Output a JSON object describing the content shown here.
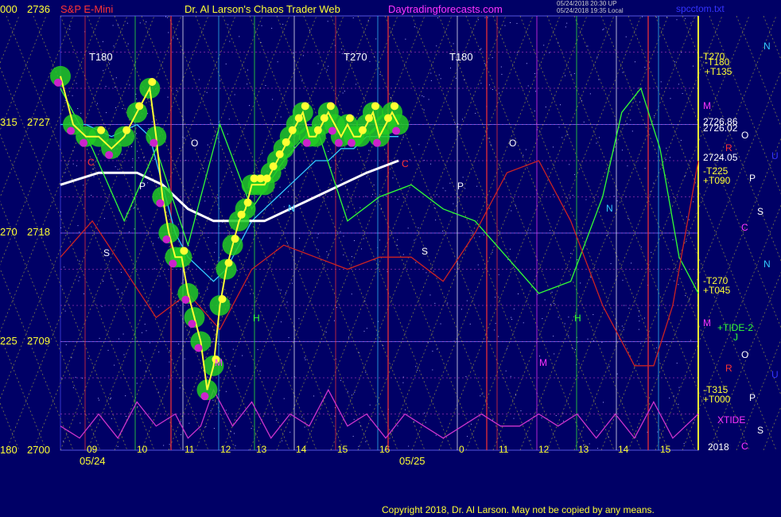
{
  "header": {
    "price_scale": "000",
    "price_top": "2736",
    "symbol": "S&P E-Mini",
    "title": "Dr. Al Larson's Chaos Trader Web",
    "site": "Daytradingforecasts.com",
    "stamp_line1": "05/24/2018 20:30 UP",
    "stamp_line2": "05/24/2018 19:35 Local",
    "filename": "spcctom.txt"
  },
  "axis_left": [
    {
      "scale": "315",
      "price": "2727"
    },
    {
      "scale": "270",
      "price": "2718"
    },
    {
      "scale": "225",
      "price": "2709"
    },
    {
      "scale": "180",
      "price": "2700"
    }
  ],
  "dates": [
    "05/24",
    "05/25"
  ],
  "hours": [
    "09",
    "10",
    "11",
    "12",
    "13",
    "14",
    "15",
    "16",
    "0",
    "11",
    "12",
    "13",
    "14",
    "15"
  ],
  "time_markers": [
    "T180",
    "T270",
    "T180"
  ],
  "right_labels": [
    {
      "text": "-T270",
      "color": "#ffff33"
    },
    {
      "text": "-T180",
      "color": "#ffff33"
    },
    {
      "text": "+T135",
      "color": "#ffff33"
    },
    {
      "text": "M",
      "color": "#ff33ff"
    },
    {
      "text": "2726.86",
      "color": "#ffffff"
    },
    {
      "text": "2726.02",
      "color": "#ffffff"
    },
    {
      "text": "R",
      "color": "#ff3333"
    },
    {
      "text": "2724.05",
      "color": "#ffffff"
    },
    {
      "text": "-T225",
      "color": "#ffff33"
    },
    {
      "text": "+T090",
      "color": "#ffff33"
    },
    {
      "text": "-T270",
      "color": "#ffff33"
    },
    {
      "text": "+T045",
      "color": "#ffff33"
    },
    {
      "text": "M",
      "color": "#ff33ff"
    },
    {
      "text": "+TIDE-2",
      "color": "#33ff33"
    },
    {
      "text": "-T315",
      "color": "#ffff33"
    },
    {
      "text": "+T000",
      "color": "#ffff33"
    },
    {
      "text": "XTIDE",
      "color": "#ff33ff"
    },
    {
      "text": "2018",
      "color": "#ffffff"
    }
  ],
  "planet_column": [
    {
      "text": "N",
      "color": "#33ccff"
    },
    {
      "text": "O",
      "color": "#ffffff"
    },
    {
      "text": "U",
      "color": "#3333ff"
    },
    {
      "text": "P",
      "color": "#ffffff"
    },
    {
      "text": "S",
      "color": "#ffffff"
    },
    {
      "text": "C",
      "color": "#ff33ff"
    },
    {
      "text": "N",
      "color": "#33ccff"
    },
    {
      "text": "J",
      "color": "#33ff33"
    },
    {
      "text": "O",
      "color": "#ffffff"
    },
    {
      "text": "R",
      "color": "#ff3333"
    },
    {
      "text": "U",
      "color": "#3333ff"
    },
    {
      "text": "P",
      "color": "#ffffff"
    },
    {
      "text": "S",
      "color": "#ffffff"
    },
    {
      "text": "C",
      "color": "#ff33ff"
    }
  ],
  "in_chart_letters": [
    "O",
    "P",
    "N",
    "S",
    "H",
    "M",
    "C",
    "O",
    "P",
    "N",
    "S",
    "H",
    "M",
    "C"
  ],
  "copyright": "Copyright 2018, Dr. Al Larson. May not be copied by any means.",
  "chart_data": {
    "type": "line",
    "ylim": [
      2700,
      2736
    ],
    "y_ticks": [
      2700,
      2709,
      2718,
      2727,
      2736
    ],
    "x_range": [
      0,
      100
    ],
    "price": {
      "x": [
        0,
        2,
        4,
        6,
        8,
        10,
        12,
        14,
        15,
        16,
        17,
        18,
        19,
        20,
        21,
        22,
        23,
        24,
        25,
        26,
        27,
        28,
        29,
        30,
        31,
        32,
        33,
        34,
        35,
        36,
        37,
        38,
        39,
        40,
        41,
        42,
        43,
        44,
        45,
        46,
        47,
        48,
        49,
        50,
        51,
        52,
        53
      ],
      "y": [
        2731,
        2727,
        2726,
        2726,
        2725,
        2726,
        2728,
        2730,
        2726,
        2721,
        2718,
        2716,
        2716,
        2713,
        2711,
        2709,
        2705,
        2707,
        2712,
        2715,
        2717,
        2719,
        2720,
        2722,
        2722,
        2722,
        2723,
        2724,
        2725,
        2726,
        2727,
        2728,
        2726,
        2726,
        2727,
        2728,
        2727,
        2726,
        2727,
        2726,
        2726,
        2727,
        2728,
        2726,
        2727,
        2728,
        2727
      ]
    },
    "series": [
      {
        "color": "#33ccff",
        "x": [
          0,
          4,
          8,
          12,
          14,
          16,
          18,
          20,
          22,
          24,
          26,
          28,
          30,
          32,
          34,
          36,
          38,
          40,
          42,
          44,
          46,
          48,
          50,
          53
        ],
        "y": [
          2727,
          2727,
          2726,
          2727,
          2726,
          2722,
          2718,
          2716,
          2715,
          2714,
          2715,
          2717,
          2719,
          2720,
          2721,
          2722,
          2723,
          2724,
          2724,
          2725,
          2725,
          2726,
          2726,
          2726
        ]
      },
      {
        "color": "#ffffff",
        "x": [
          0,
          6,
          12,
          16,
          20,
          24,
          28,
          32,
          36,
          40,
          44,
          48,
          53
        ],
        "y": [
          2722,
          2723,
          2723,
          2722,
          2720,
          2719,
          2719,
          2719,
          2720,
          2721,
          2722,
          2723,
          2724
        ]
      },
      {
        "color": "#33ff33",
        "x": [
          0,
          5,
          10,
          15,
          20,
          25,
          30,
          35,
          40,
          45,
          50,
          55,
          60,
          65,
          70,
          75,
          80,
          85,
          88,
          91,
          94,
          97,
          100
        ],
        "y": [
          2730,
          2725,
          2719,
          2725,
          2717,
          2727,
          2720,
          2724,
          2727,
          2719,
          2721,
          2722,
          2720,
          2719,
          2716,
          2713,
          2714,
          2721,
          2728,
          2730,
          2725,
          2716,
          2713
        ]
      },
      {
        "color": "#cc2222",
        "x": [
          0,
          5,
          10,
          15,
          20,
          25,
          30,
          35,
          40,
          45,
          50,
          55,
          60,
          65,
          70,
          75,
          80,
          85,
          90,
          93,
          96,
          100
        ],
        "y": [
          2716,
          2719,
          2715,
          2711,
          2713,
          2710,
          2715,
          2717,
          2716,
          2715,
          2716,
          2716,
          2714,
          2718,
          2723,
          2724,
          2719,
          2712,
          2707,
          2707,
          2712,
          2724
        ]
      },
      {
        "color": "#cc33cc",
        "x": [
          0,
          3,
          6,
          9,
          12,
          15,
          18,
          20,
          22,
          24,
          27,
          30,
          33,
          36,
          39,
          42,
          45,
          48,
          51,
          54,
          57,
          60,
          63,
          66,
          69,
          72,
          75,
          78,
          81,
          84,
          87,
          90,
          93,
          96,
          100
        ],
        "y": [
          2702,
          2701,
          2703,
          2701,
          2704,
          2702,
          2703,
          2701,
          2702,
          2705,
          2702,
          2704,
          2701,
          2703,
          2702,
          2705,
          2702,
          2703,
          2701,
          2703,
          2702,
          2701,
          2702,
          2703,
          2702,
          2702,
          2703,
          2702,
          2703,
          2701,
          2703,
          2701,
          2704,
          2701,
          2703
        ]
      }
    ]
  }
}
